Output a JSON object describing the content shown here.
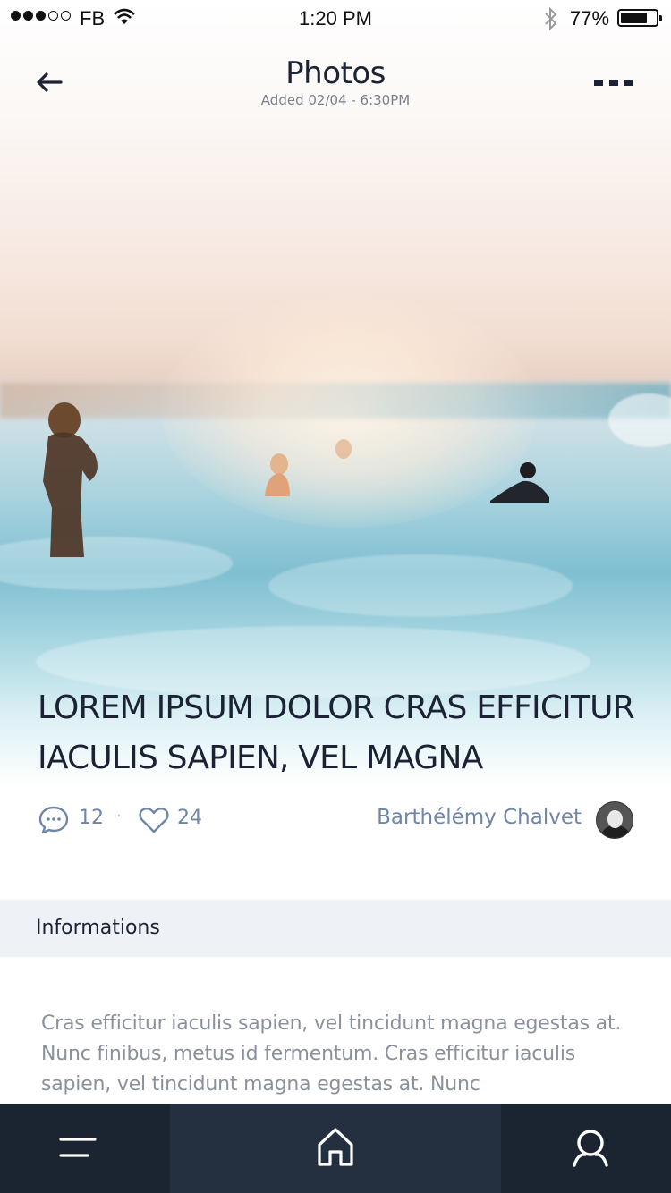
{
  "status_bar": {
    "carrier": "FB",
    "time": "1:20 PM",
    "battery_percent": "77%",
    "battery_level": 0.77,
    "signal_bars": 3,
    "signal_total": 5
  },
  "header": {
    "title": "Photos",
    "subtitle": "Added 02/04 - 6:30PM",
    "back_icon": "arrow-left-icon",
    "more_icon": "ellipsis-icon"
  },
  "post": {
    "headline": "LOREM IPSUM DOLOR CRAS EFFICITUR IACULIS SAPIEN, VEL MAGNA",
    "comments": "12",
    "likes": "24",
    "author": "Barthélémy Chalvet"
  },
  "section": {
    "title": "Informations",
    "body": "Cras efficitur iaculis sapien, vel tincidunt magna egestas at. Nunc finibus, metus id fermentum. Cras efficitur iaculis sapien, vel tincidunt magna egestas at. Nunc"
  },
  "tab_bar": {
    "items": [
      {
        "icon": "menu-icon"
      },
      {
        "icon": "home-icon",
        "active": true
      },
      {
        "icon": "search-icon"
      }
    ]
  },
  "colors": {
    "dark": "#1b2233",
    "meta": "#6f86a8",
    "tab_bg": "#1b2431",
    "tab_active": "#243040",
    "section_bg": "#eef1f5"
  }
}
